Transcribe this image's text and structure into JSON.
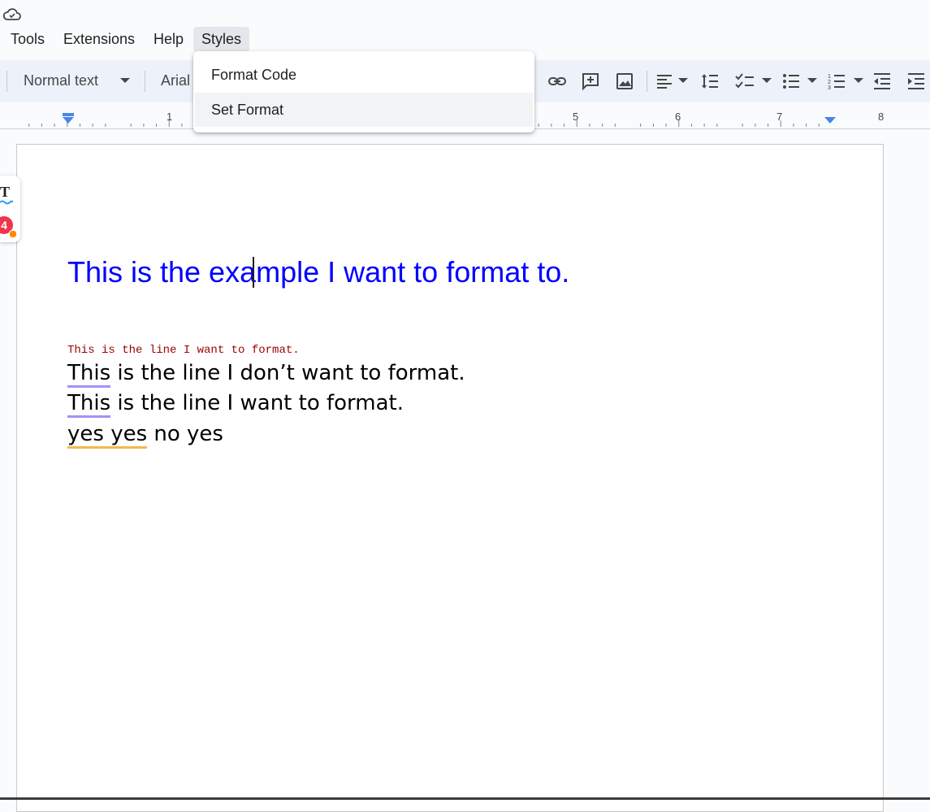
{
  "app": {
    "save_status_icon": "cloud-icon"
  },
  "menubar": {
    "items": [
      {
        "label": "Tools"
      },
      {
        "label": "Extensions"
      },
      {
        "label": "Help"
      },
      {
        "label": "Styles",
        "active": true
      }
    ]
  },
  "toolbar": {
    "paragraph_style": "Normal text",
    "font_family": "Arial",
    "icons": [
      "link-icon",
      "add-comment-icon",
      "insert-image-icon",
      "align-left-icon",
      "line-spacing-icon",
      "checklist-icon",
      "bulleted-list-icon",
      "numbered-list-icon",
      "decrease-indent-icon",
      "increase-indent-icon"
    ]
  },
  "ruler": {
    "numbers": [
      "1",
      "5",
      "6",
      "7",
      "8"
    ]
  },
  "dropdown": {
    "items": [
      {
        "label": "Format Code"
      },
      {
        "label": "Set Format",
        "hovered": true
      }
    ]
  },
  "side_widget": {
    "letter": "T",
    "badge_count": "4"
  },
  "document": {
    "heading": "This is the example I want to format to.",
    "code_line": "This is the line I want to format.",
    "lines": [
      {
        "underlined": "This",
        "rest": " is the line I don’t want to format."
      },
      {
        "underlined": "This",
        "rest": " is the line I want to format."
      },
      {
        "underlined": "yes yes",
        "rest": " no yes"
      }
    ]
  },
  "colors": {
    "heading": "#0000ff",
    "code": "#990000",
    "toolbar_bg": "#edf2fa",
    "grammar_underline": "#a393f5",
    "spelling_underline": "#f6b94e"
  }
}
